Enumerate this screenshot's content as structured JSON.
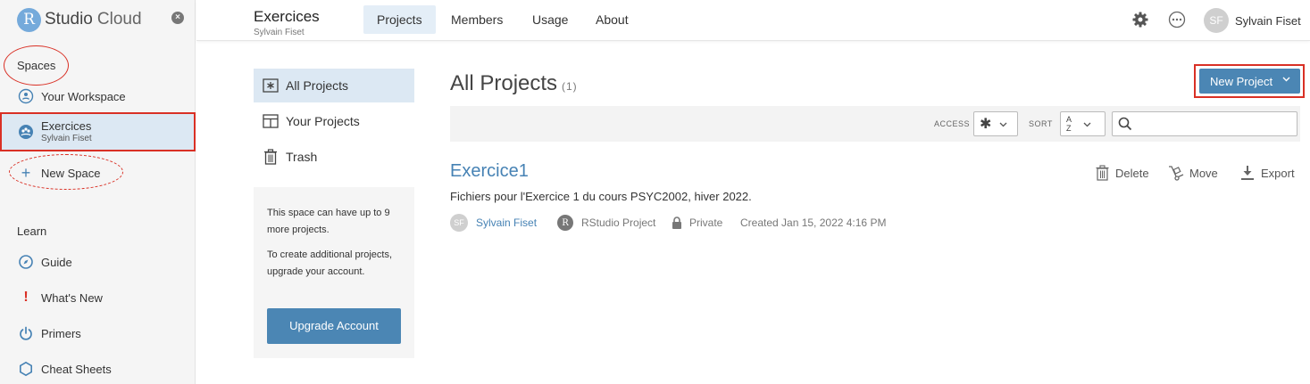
{
  "brand": {
    "logo_letter": "R",
    "name": "Studio",
    "suffix": "Cloud",
    "close_glyph": "×"
  },
  "sidebar": {
    "spaces_label": "Spaces",
    "your_workspace": "Your Workspace",
    "current_space": {
      "name": "Exercices",
      "owner": "Sylvain Fiset"
    },
    "new_space": "New Space",
    "learn_label": "Learn",
    "learn_items": [
      {
        "label": "Guide",
        "icon": "compass-icon"
      },
      {
        "label": "What's New",
        "icon": "exclamation-icon"
      },
      {
        "label": "Primers",
        "icon": "power-icon"
      },
      {
        "label": "Cheat Sheets",
        "icon": "hexagon-icon"
      }
    ]
  },
  "header": {
    "space_title": "Exercices",
    "space_owner": "Sylvain Fiset",
    "tabs": [
      {
        "label": "Projects",
        "active": true
      },
      {
        "label": "Members",
        "active": false
      },
      {
        "label": "Usage",
        "active": false
      },
      {
        "label": "About",
        "active": false
      }
    ],
    "user": {
      "initials": "SF",
      "name": "Sylvain Fiset"
    }
  },
  "subnav": {
    "items": [
      {
        "label": "All Projects",
        "active": true,
        "icon": "asterisk-box-icon"
      },
      {
        "label": "Your Projects",
        "active": false,
        "icon": "grid-icon"
      },
      {
        "label": "Trash",
        "active": false,
        "icon": "trash-icon"
      }
    ],
    "info_line1": "This space can have up to 9 more projects.",
    "info_line2": "To create additional projects, upgrade your account.",
    "upgrade_button": "Upgrade Account"
  },
  "main": {
    "title": "All Projects",
    "count": "(1)",
    "new_project_button": "New Project",
    "filters": {
      "access_label": "ACCESS",
      "access_value": "✱",
      "sort_label": "SORT",
      "sort_value_top": "A",
      "sort_value_bottom": "Z",
      "search_placeholder": ""
    },
    "project": {
      "name": "Exercice1",
      "description": "Fichiers pour l'Exercice 1 du cours PSYC2002, hiver 2022.",
      "owner_initials": "SF",
      "owner": "Sylvain Fiset",
      "type_letter": "R",
      "type": "RStudio Project",
      "visibility": "Private",
      "created": "Created Jan 15, 2022 4:16 PM",
      "actions": {
        "delete": "Delete",
        "move": "Move",
        "export": "Export"
      }
    }
  },
  "colors": {
    "accent": "#4b86b4",
    "link": "#4682b4",
    "annotation": "#d93025",
    "active_bg": "#dce8f3"
  }
}
